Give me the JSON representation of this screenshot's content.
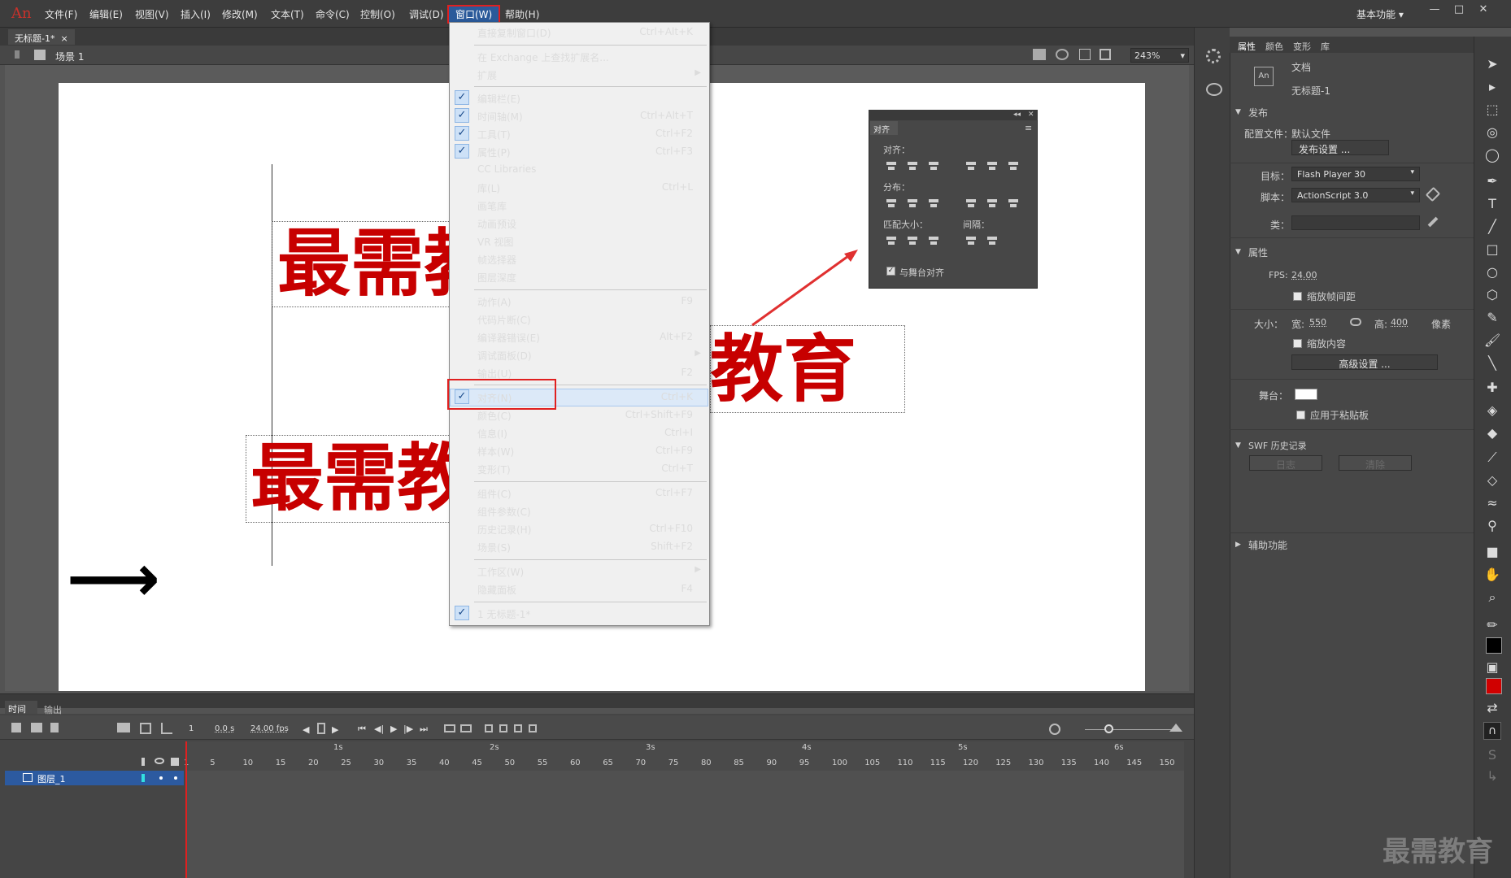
{
  "app": {
    "logo": "An"
  },
  "menubar": {
    "items": [
      "文件(F)",
      "编辑(E)",
      "视图(V)",
      "插入(I)",
      "修改(M)",
      "文本(T)",
      "命令(C)",
      "控制(O)",
      "调试(D)",
      "窗口(W)",
      "帮助(H)"
    ],
    "workspace": "基本功能",
    "workspace_arrow": "▾",
    "win_controls": [
      "—",
      "□",
      "✕"
    ]
  },
  "document": {
    "tab": "无标题-1*",
    "tab_close": "×",
    "scene": "场景 1",
    "zoom": "243%",
    "zoom_arrow": "▾"
  },
  "stage_text": {
    "text_top": "最需教",
    "text_bottom": "最需教",
    "text_right": "教育",
    "arrow": "⟶"
  },
  "window_menu": {
    "items": [
      {
        "label": "直接复制窗口(D)",
        "shortcut": "Ctrl+Alt+K"
      },
      {
        "label": "在 Exchange 上查找扩展名...",
        "shortcut": ""
      },
      {
        "label": "扩展",
        "shortcut": ""
      },
      {
        "label": "编辑栏(E)",
        "shortcut": ""
      },
      {
        "label": "时间轴(M)",
        "shortcut": "Ctrl+Alt+T"
      },
      {
        "label": "工具(T)",
        "shortcut": "Ctrl+F2"
      },
      {
        "label": "属性(P)",
        "shortcut": "Ctrl+F3"
      },
      {
        "label": "CC Libraries",
        "shortcut": ""
      },
      {
        "label": "库(L)",
        "shortcut": "Ctrl+L"
      },
      {
        "label": "画笔库",
        "shortcut": ""
      },
      {
        "label": "动画预设",
        "shortcut": ""
      },
      {
        "label": "VR 视图",
        "shortcut": ""
      },
      {
        "label": "帧选择器",
        "shortcut": ""
      },
      {
        "label": "图层深度",
        "shortcut": ""
      },
      {
        "label": "动作(A)",
        "shortcut": "F9"
      },
      {
        "label": "代码片断(C)",
        "shortcut": ""
      },
      {
        "label": "编译器错误(E)",
        "shortcut": "Alt+F2"
      },
      {
        "label": "调试面板(D)",
        "shortcut": ""
      },
      {
        "label": "输出(U)",
        "shortcut": "F2"
      },
      {
        "label": "对齐(N)",
        "shortcut": "Ctrl+K"
      },
      {
        "label": "颜色(C)",
        "shortcut": "Ctrl+Shift+F9"
      },
      {
        "label": "信息(I)",
        "shortcut": "Ctrl+I"
      },
      {
        "label": "样本(W)",
        "shortcut": "Ctrl+F9"
      },
      {
        "label": "变形(T)",
        "shortcut": "Ctrl+T"
      },
      {
        "label": "组件(C)",
        "shortcut": "Ctrl+F7"
      },
      {
        "label": "组件参数(C)",
        "shortcut": ""
      },
      {
        "label": "历史记录(H)",
        "shortcut": "Ctrl+F10"
      },
      {
        "label": "场景(S)",
        "shortcut": "Shift+F2"
      },
      {
        "label": "工作区(W)",
        "shortcut": ""
      },
      {
        "label": "隐藏面板",
        "shortcut": "F4"
      },
      {
        "label": "1 无标题-1*",
        "shortcut": ""
      }
    ],
    "checked_mark": "✓",
    "submenu_arrow": "▶"
  },
  "align_panel": {
    "tab": "对齐",
    "collapse": "◂◂",
    "close": "✕",
    "menu": "≡",
    "align_label": "对齐：",
    "distribute_label": "分布：",
    "match_size_label": "匹配大小：",
    "spacing_label": "间隔：",
    "stage_align": "与舞台对齐",
    "stage_align_check": "✓"
  },
  "properties": {
    "tabs": [
      "属性",
      "颜色",
      "变形",
      "库"
    ],
    "doc_type": "文档",
    "doc_name": "无标题-1",
    "doc_icon": "An",
    "publish_section": "发布",
    "profile_label": "配置文件：",
    "profile_value": "默认文件",
    "publish_settings_btn": "发布设置 ...",
    "target_label": "目标：",
    "target_value": "Flash Player 30",
    "script_label": "脚本：",
    "script_value": "ActionScript 3.0",
    "class_label": "类：",
    "props_section": "属性",
    "fps_label": "FPS:",
    "fps_value": "24.00",
    "scale_spacing": "缩放帧间距",
    "size_label": "大小：",
    "width_label": "宽:",
    "width_value": "550",
    "height_label": "高:",
    "height_value": "400",
    "unit": "像素",
    "scale_content": "缩放内容",
    "advanced_btn": "高级设置 ...",
    "stage_label": "舞台：",
    "apply_pasteboard": "应用于粘贴板",
    "swf_history": "SWF 历史记录",
    "log_btn": "日志",
    "clear_btn": "清除",
    "accessibility": "辅助功能",
    "section_open": "▼",
    "section_closed": "▶",
    "dropdown_arrow": "▾"
  },
  "timeline": {
    "tab": "时间轴",
    "tab_output": "输出",
    "frame": "1",
    "time": "0.0 s",
    "fps": "24.00 fps",
    "layer_name": "图层_1",
    "seconds": [
      "1s",
      "2s",
      "3s",
      "4s",
      "5s",
      "6s"
    ],
    "frame_ticks": [
      "1",
      "5",
      "10",
      "15",
      "20",
      "25",
      "30",
      "35",
      "40",
      "45",
      "50",
      "55",
      "60",
      "65",
      "70",
      "75",
      "80",
      "85",
      "90",
      "95",
      "100",
      "105",
      "110",
      "115",
      "120",
      "125",
      "130",
      "135",
      "140",
      "145",
      "150"
    ],
    "play_controls": [
      "⏮",
      "◀|",
      "▶",
      "|▶",
      "⏭"
    ]
  },
  "watermark": "最需教育",
  "colors": {
    "accent_red": "#e02020",
    "text_red": "#c70000",
    "menu_highlight": "#2b5a9a",
    "layer_blue": "#2c5aa0"
  }
}
